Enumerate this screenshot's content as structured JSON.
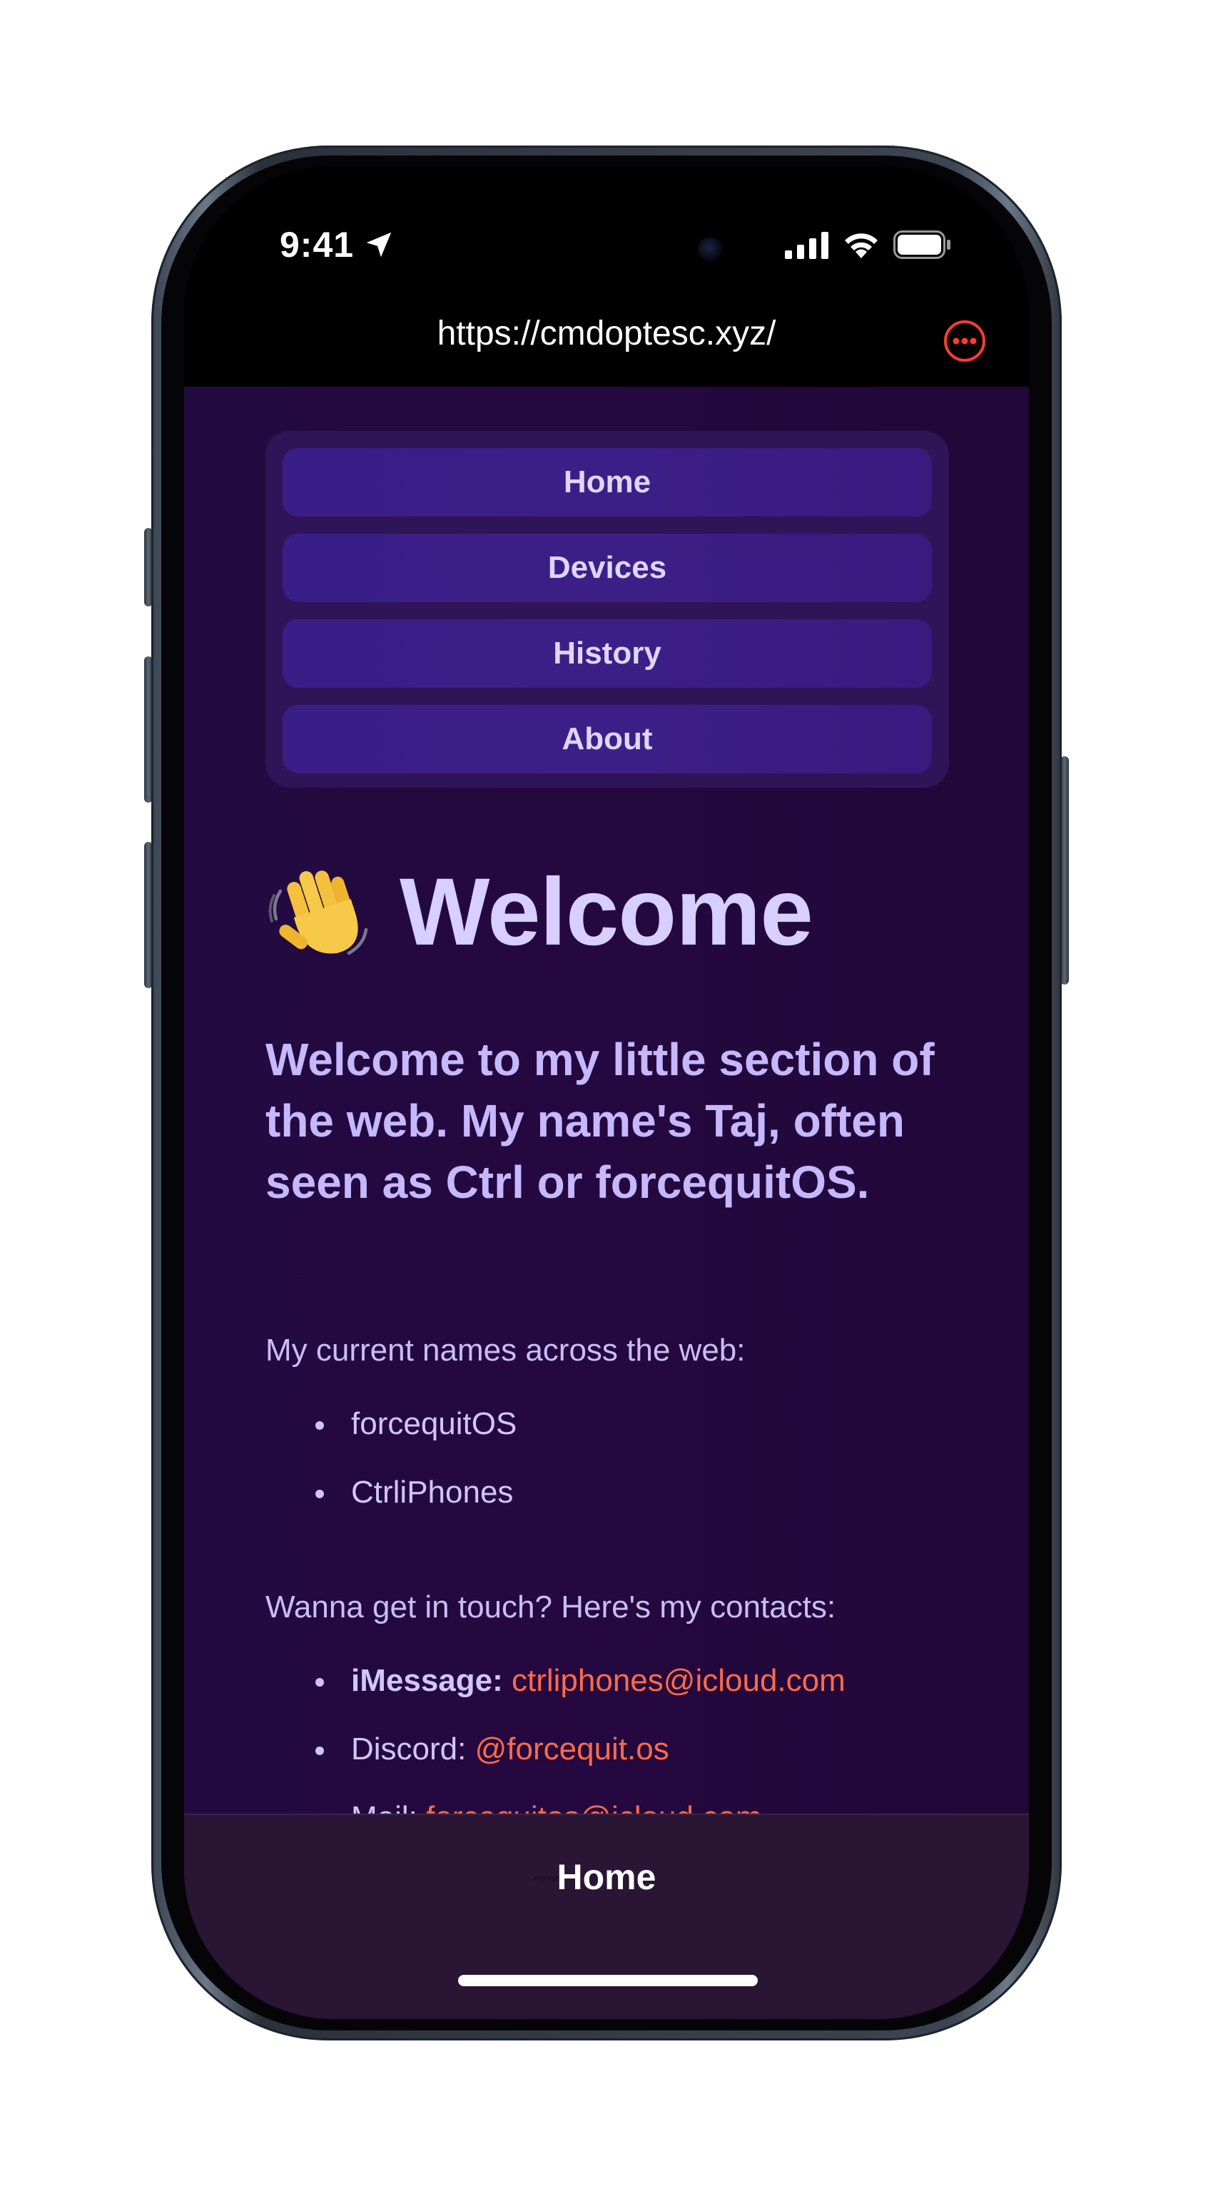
{
  "status_bar": {
    "time": "9:41",
    "icons": [
      "location-arrow-icon",
      "cellular-signal-icon",
      "wifi-icon",
      "battery-icon"
    ]
  },
  "browser": {
    "url": "https://cmdoptesc.xyz/",
    "more_icon": "ellipsis-circle-icon",
    "accent_color": "#ff3b30"
  },
  "nav": {
    "items": [
      {
        "label": "Home"
      },
      {
        "label": "Devices"
      },
      {
        "label": "History"
      },
      {
        "label": "About"
      }
    ]
  },
  "hero": {
    "emoji": "waving-hand-icon",
    "title": "Welcome",
    "intro": "Welcome to my little section of the web. My name's Taj, often seen as Ctrl or forcequitOS."
  },
  "names": {
    "heading": "My current names across the web:",
    "items": [
      "forcequitOS",
      "CtrliPhones"
    ]
  },
  "contacts": {
    "heading": "Wanna get in touch? Here's my contacts:",
    "items": [
      {
        "label": "iMessage:",
        "value": "ctrliphones@icloud.com"
      },
      {
        "label": "Discord:",
        "value": "@forcequit.os"
      },
      {
        "label": "Mail:",
        "value": "forcequitos@icloud.com"
      }
    ]
  },
  "tab_bar": {
    "title": "Home"
  },
  "colors": {
    "page_background": "#230a40",
    "nav_button": "#3a1e87",
    "heading": "#d6cfff",
    "link": "#ff6a4a"
  }
}
